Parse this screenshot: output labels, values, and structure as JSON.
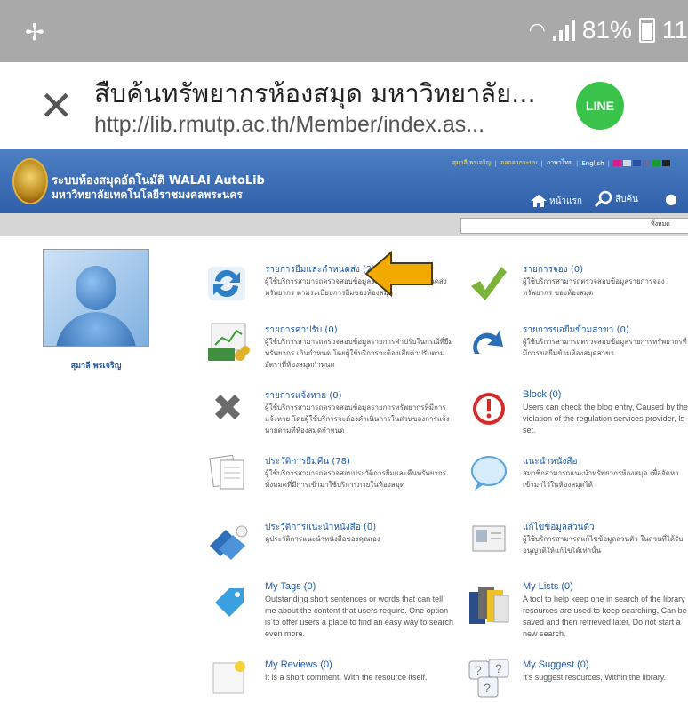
{
  "status_bar": {
    "battery_percent": "81%",
    "time_partial": "11"
  },
  "browser": {
    "close_icon": "close-icon",
    "title": "สืบค้นทรัพยากรห้องสมุด มหาวิทยาลัย...",
    "url": "http://lib.rmutp.ac.th/Member/index.as...",
    "share_app": "LINE"
  },
  "site": {
    "name_line1": "ระบบห้องสมุดอัตโนมัติ WALAI AutoLib",
    "name_line2": "มหาวิทยาลัยเทคโนโลยีราชมงคลพระนคร",
    "top_links": {
      "user": "สุมาลี พรเจริญ",
      "logout": "ออกจากระบบ",
      "language": "ภาษาไทย",
      "english": "English"
    },
    "nav": {
      "home": "หน้าแรก",
      "search": "สืบค้น"
    },
    "search": {
      "scope": "ทั้งหมด",
      "placeholder": ""
    },
    "theme_colors": [
      "#d81b8c",
      "#cfd8e8",
      "#2a4fa0",
      "#5c6ea8",
      "#1c9a38",
      "#222222"
    ]
  },
  "profile": {
    "name": "สุมาลี พรเจริญ"
  },
  "menu": {
    "borrow": {
      "title": "รายการยืมและกำหนดส่ง (2)",
      "desc": "ผู้ใช้บริการสามารถตรวจสอบข้อมูลรายการยืมและกำหนดส่งทรัพยากร ตามระเบียบการยืมของห้องสมุด"
    },
    "reserve": {
      "title": "รายการจอง (0)",
      "desc": "ผู้ใช้บริการสามารถตรวจสอบข้อมูลรายการจองทรัพยากร ของห้องสมุด"
    },
    "fines": {
      "title": "รายการค่าปรับ (0)",
      "desc": "ผู้ใช้บริการสามารถตรวจสอบข้อมูลรายการค่าปรับในกรณีที่ยืมทรัพยากร เกินกำหนด โดยผู้ใช้บริการจะต้องเสียค่าปรับตามอัตราที่ห้องสมุดกำหนด"
    },
    "interloan": {
      "title": "รายการขอยืมข้ามสาขา (0)",
      "desc": "ผู้ใช้บริการสามารถตรวจสอบข้อมูลรายการทรัพยากรที่มีการขอยืมข้ามห้องสมุดสาขา"
    },
    "lost": {
      "title": "รายการแจ้งหาย (0)",
      "desc": "ผู้ใช้บริการสามารถตรวจสอบข้อมูลรายการทรัพยากรที่มีการแจ้งหาย โดยผู้ใช้บริการจะต้องดำเนินการในส่วนของการแจ้งหายตามที่ห้องสมุดกำหนด"
    },
    "block": {
      "title": "Block (0)",
      "desc": "Users can check the blog entry, Caused by the violation of the regulation services provider, Is set."
    },
    "history": {
      "title": "ประวัติการยืมคืน (78)",
      "desc": "ผู้ใช้บริการสามารถตรวจสอบประวัติการยืมและคืนทรัพยากร ทั้งหมดที่มีการเข้ามาใช้บริการภายในห้องสมุด"
    },
    "recommend": {
      "title": "แนะนำหนังสือ",
      "desc": "สมาชิกสามารถแนะนำทรัพยากรห้องสมุด เพื่อจัดหาเข้ามาไว้ในห้องสมุดได้"
    },
    "rec_history": {
      "title": "ประวัติการแนะนำหนังสือ (0)",
      "desc": "ดูประวัติการแนะนำหนังสือของคุณเอง"
    },
    "edit_profile": {
      "title": "แก้ไขข้อมูลส่วนตัว",
      "desc": "ผู้ใช้บริการสามารถแก้ไขข้อมูลส่วนตัว ในส่วนที่ได้รับอนุญาติให้แก้ไขได้เท่านั้น"
    },
    "tags": {
      "title": "My Tags (0)",
      "desc": "Outstanding short sentences or words that can tell me about the content that users require. One option is to offer users a place to find an easy way to search even more."
    },
    "lists": {
      "title": "My Lists (0)",
      "desc": "A tool to help keep one in search of the library resources are used to keep searching, Can be saved and then retrieved later, Do not start a new search."
    },
    "reviews": {
      "title": "My Reviews (0)",
      "desc": "It is a short comment, With the resource itself."
    },
    "suggest": {
      "title": "My Suggest (0)",
      "desc": "It's suggest resources, Within the library."
    }
  },
  "annotation_arrow_color": "#f2a900"
}
